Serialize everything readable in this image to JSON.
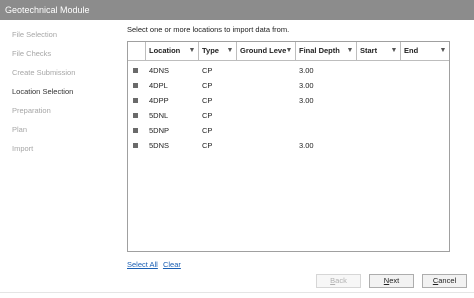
{
  "window": {
    "title": "Geotechnical Module"
  },
  "sidebar": {
    "steps": [
      {
        "label": "File Selection"
      },
      {
        "label": "File Checks"
      },
      {
        "label": "Create Submission"
      },
      {
        "label": "Location Selection"
      },
      {
        "label": "Preparation"
      },
      {
        "label": "Plan"
      },
      {
        "label": "Import"
      }
    ],
    "active_index": 3
  },
  "main": {
    "instruction": "Select one or more locations to import data from.",
    "table": {
      "columns": [
        "Location",
        "Type",
        "Ground Leve",
        "Final Depth",
        "Start",
        "End"
      ],
      "rows": [
        {
          "location": "4DNS",
          "type": "CP",
          "ground_level": "",
          "final_depth": "3.00",
          "start": "",
          "end": ""
        },
        {
          "location": "4DPL",
          "type": "CP",
          "ground_level": "",
          "final_depth": "3.00",
          "start": "",
          "end": ""
        },
        {
          "location": "4DPP",
          "type": "CP",
          "ground_level": "",
          "final_depth": "3.00",
          "start": "",
          "end": ""
        },
        {
          "location": "5DNL",
          "type": "CP",
          "ground_level": "",
          "final_depth": "",
          "start": "",
          "end": ""
        },
        {
          "location": "5DNP",
          "type": "CP",
          "ground_level": "",
          "final_depth": "",
          "start": "",
          "end": ""
        },
        {
          "location": "5DNS",
          "type": "CP",
          "ground_level": "",
          "final_depth": "3.00",
          "start": "",
          "end": ""
        }
      ]
    },
    "select_all_label": "Select All",
    "clear_label": "Clear"
  },
  "footer": {
    "back": {
      "mnemonic": "B",
      "rest": "ack"
    },
    "next": {
      "mnemonic": "N",
      "rest": "ext"
    },
    "cancel": {
      "mnemonic": "C",
      "rest": "ancel"
    }
  },
  "colors": {
    "titlebar": "#8c8c8c",
    "link": "#1a5fb4",
    "step_inactive": "#a6a6a6"
  },
  "icons": {
    "filter": "filter-icon",
    "row_checkbox": "checkbox"
  }
}
